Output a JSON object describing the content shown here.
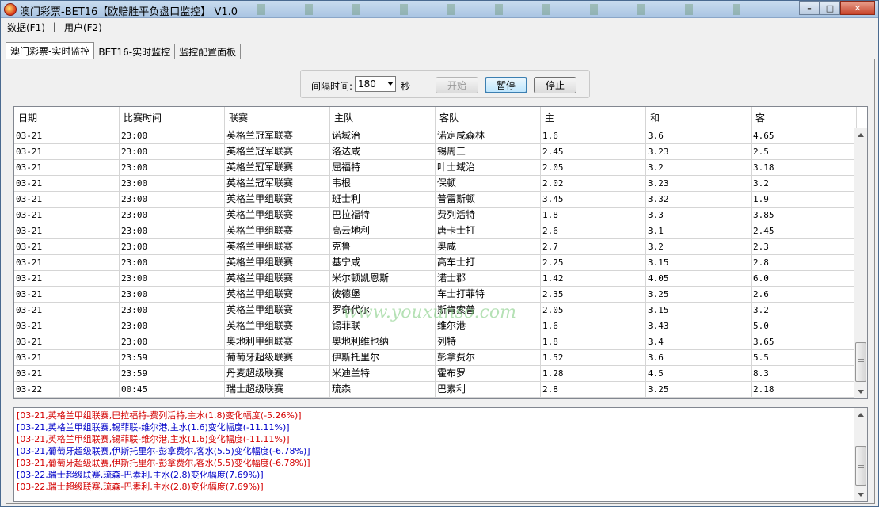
{
  "window": {
    "title": "澳门彩票-BET16【欧赔胜平负盘口监控】 V1.0",
    "min_symbol": "–",
    "max_symbol": "□",
    "close_symbol": "✕"
  },
  "menu": {
    "items": [
      "数据(F1)",
      "用户(F2)"
    ],
    "separator": "|"
  },
  "tabs": [
    "澳门彩票-实时监控",
    "BET16-实时监控",
    "监控配置面板"
  ],
  "controls": {
    "interval_label": "间隔时间:",
    "interval_value": "180",
    "interval_unit": "秒",
    "start_label": "开始",
    "pause_label": "暂停",
    "stop_label": "停止"
  },
  "grid": {
    "columns": [
      "日期",
      "比赛时间",
      "联赛",
      "主队",
      "客队",
      "主",
      "和",
      "客"
    ],
    "rows": [
      [
        "03-21",
        "23:00",
        "英格兰冠军联赛",
        "诺域治",
        "诺定咸森林",
        "1.6",
        "3.6",
        "4.65"
      ],
      [
        "03-21",
        "23:00",
        "英格兰冠军联赛",
        "洛达咸",
        "锡周三",
        "2.45",
        "3.23",
        "2.5"
      ],
      [
        "03-21",
        "23:00",
        "英格兰冠军联赛",
        "屈福特",
        "叶士域治",
        "2.05",
        "3.2",
        "3.18"
      ],
      [
        "03-21",
        "23:00",
        "英格兰冠军联赛",
        "韦根",
        "保顿",
        "2.02",
        "3.23",
        "3.2"
      ],
      [
        "03-21",
        "23:00",
        "英格兰甲组联赛",
        "班士利",
        "普雷斯顿",
        "3.45",
        "3.32",
        "1.9"
      ],
      [
        "03-21",
        "23:00",
        "英格兰甲组联赛",
        "巴拉福特",
        "费列活特",
        "1.8",
        "3.3",
        "3.85"
      ],
      [
        "03-21",
        "23:00",
        "英格兰甲组联赛",
        "高云地利",
        "唐卡士打",
        "2.6",
        "3.1",
        "2.45"
      ],
      [
        "03-21",
        "23:00",
        "英格兰甲组联赛",
        "克鲁",
        "奥咸",
        "2.7",
        "3.2",
        "2.3"
      ],
      [
        "03-21",
        "23:00",
        "英格兰甲组联赛",
        "基宁咸",
        "高车士打",
        "2.25",
        "3.15",
        "2.8"
      ],
      [
        "03-21",
        "23:00",
        "英格兰甲组联赛",
        "米尔顿凯恩斯",
        "诺士郡",
        "1.42",
        "4.05",
        "6.0"
      ],
      [
        "03-21",
        "23:00",
        "英格兰甲组联赛",
        "彼德堡",
        "车士打菲特",
        "2.35",
        "3.25",
        "2.6"
      ],
      [
        "03-21",
        "23:00",
        "英格兰甲组联赛",
        "罗奇代尔",
        "斯肯索普",
        "2.05",
        "3.15",
        "3.2"
      ],
      [
        "03-21",
        "23:00",
        "英格兰甲组联赛",
        "锡菲联",
        "维尔港",
        "1.6",
        "3.43",
        "5.0"
      ],
      [
        "03-21",
        "23:00",
        "奥地利甲组联赛",
        "奥地利维也纳",
        "列特",
        "1.8",
        "3.4",
        "3.65"
      ],
      [
        "03-21",
        "23:59",
        "葡萄牙超级联赛",
        "伊斯托里尔",
        "彭拿费尔",
        "1.52",
        "3.6",
        "5.5"
      ],
      [
        "03-21",
        "23:59",
        "丹麦超级联赛",
        "米迪兰特",
        "霍布罗",
        "1.28",
        "4.5",
        "8.3"
      ],
      [
        "03-22",
        "00:45",
        "瑞士超级联赛",
        "琉森",
        "巴素利",
        "2.8",
        "3.25",
        "2.18"
      ]
    ]
  },
  "watermark": "www.youxunso.com",
  "log": [
    {
      "text": "[03-21,英格兰甲组联赛,巴拉福特-费列活特,主水(1.8)变化幅度(-5.26%)]",
      "color": "red"
    },
    {
      "text": "[03-21,英格兰甲组联赛,锡菲联-维尔港,主水(1.6)变化幅度(-11.11%)]",
      "color": "blue"
    },
    {
      "text": "[03-21,英格兰甲组联赛,锡菲联-维尔港,主水(1.6)变化幅度(-11.11%)]",
      "color": "red"
    },
    {
      "text": "[03-21,葡萄牙超级联赛,伊斯托里尔-彭拿费尔,客水(5.5)变化幅度(-6.78%)]",
      "color": "blue"
    },
    {
      "text": "[03-21,葡萄牙超级联赛,伊斯托里尔-彭拿费尔,客水(5.5)变化幅度(-6.78%)]",
      "color": "red"
    },
    {
      "text": "[03-22,瑞士超级联赛,琉森-巴素利,主水(2.8)变化幅度(7.69%)]",
      "color": "blue"
    },
    {
      "text": "[03-22,瑞士超级联赛,琉森-巴素利,主水(2.8)变化幅度(7.69%)]",
      "color": "red"
    }
  ]
}
